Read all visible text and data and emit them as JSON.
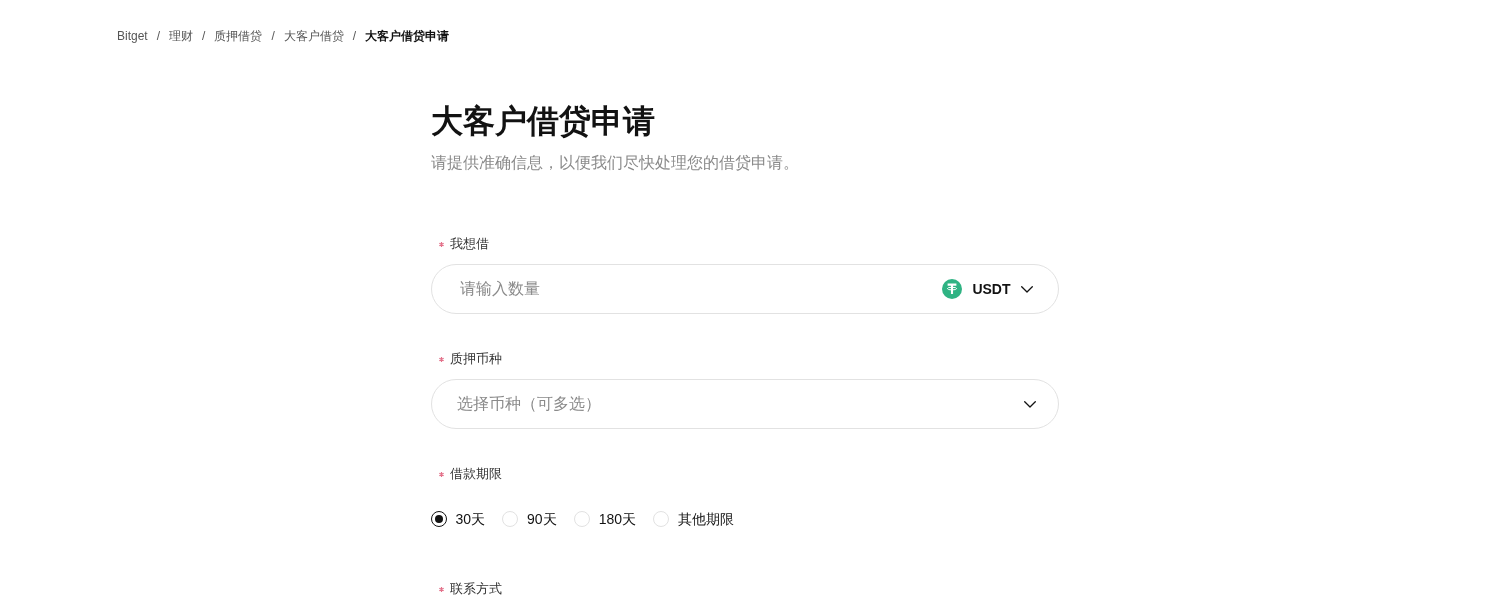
{
  "breadcrumb": [
    {
      "kind": "link",
      "label": "Bitget"
    },
    {
      "kind": "separator",
      "label": "/"
    },
    {
      "kind": "link",
      "label": "理财"
    },
    {
      "kind": "separator",
      "label": "/"
    },
    {
      "kind": "link",
      "label": "质押借贷"
    },
    {
      "kind": "separator",
      "label": "/"
    },
    {
      "kind": "link",
      "label": "大客户借贷"
    },
    {
      "kind": "separator",
      "label": "/"
    },
    {
      "kind": "current",
      "label": "大客户借贷申请"
    }
  ],
  "title": "大客户借贷申请",
  "subtitle": "请提供准确信息，以便我们尽快处理您的借贷申请。",
  "form": [
    {
      "kind": "amount",
      "label": "我想借",
      "required": true,
      "placeholder": "请输入数量",
      "currency": "USDT"
    },
    {
      "kind": "select",
      "label": "质押币种",
      "required": true,
      "placeholder": "选择币种（可多选）"
    },
    {
      "kind": "radio",
      "label": "借款期限",
      "required": true,
      "options": [
        {
          "label": "30天",
          "selected": true
        },
        {
          "label": "90天",
          "selected": false
        },
        {
          "label": "180天",
          "selected": false
        },
        {
          "label": "其他期限",
          "selected": false
        }
      ]
    },
    {
      "kind": "heading",
      "label": "联系方式",
      "required": true
    }
  ]
}
